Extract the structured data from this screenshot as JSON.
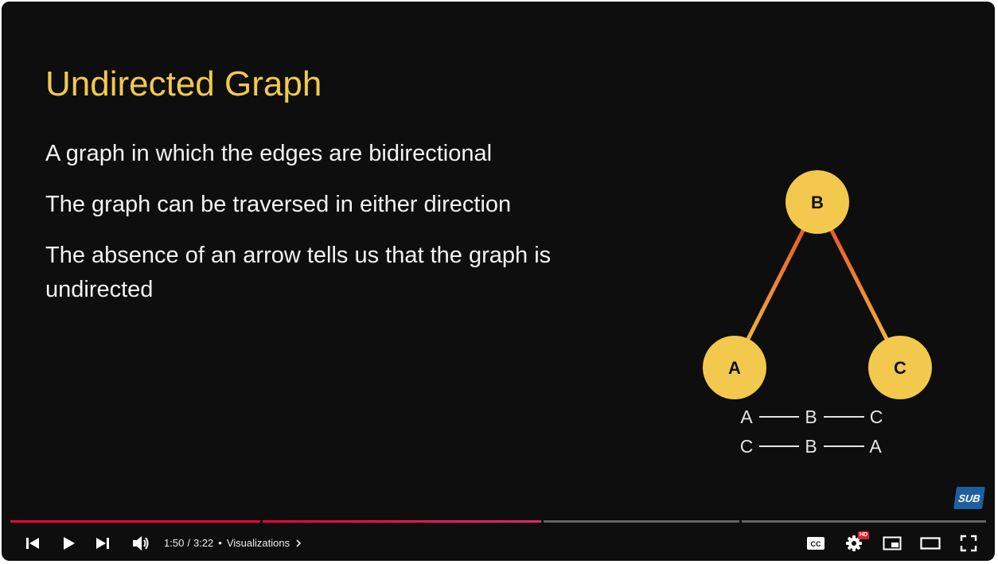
{
  "slide": {
    "title": "Undirected Graph",
    "bullets": [
      "A graph in which the edges are bidirectional",
      "The graph can be traversed in either direction",
      "The absence of an arrow tells us that the graph is undirected"
    ],
    "nodes": {
      "b": "B",
      "a": "A",
      "c": "C"
    },
    "paths": [
      [
        "A",
        "B",
        "C"
      ],
      [
        "C",
        "B",
        "A"
      ]
    ],
    "colors": {
      "title": "#f2c94c",
      "node": "#f2c94c",
      "edge_top": "#e8532a",
      "edge_bottom": "#f2b33b"
    }
  },
  "watermark": {
    "label": "SUB",
    "color": "#1e5fa0"
  },
  "player": {
    "current_time": "1:50",
    "separator": "/",
    "duration": "3:22",
    "chapter_title": "Visualizations",
    "hd_label": "HD",
    "progress_color": "#f00040",
    "progress_fraction": 0.544,
    "icons": {
      "previous": "skip-previous-icon",
      "play": "play-icon",
      "next": "skip-next-icon",
      "volume": "volume-icon",
      "captions": "closed-captions-icon",
      "settings": "gear-icon",
      "miniplayer": "miniplayer-icon",
      "theater": "theater-mode-icon",
      "fullscreen": "fullscreen-icon"
    }
  }
}
